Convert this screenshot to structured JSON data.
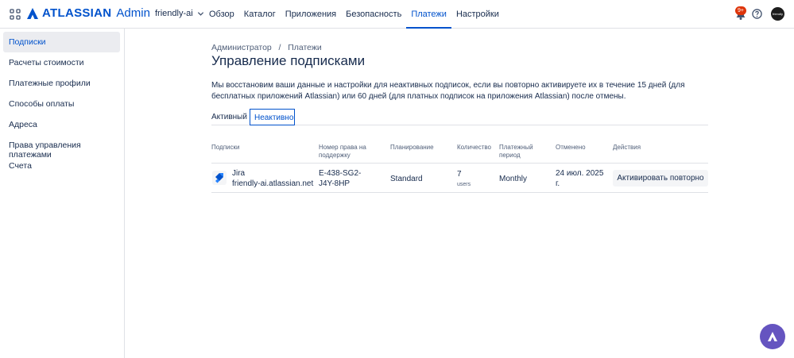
{
  "header": {
    "brand": "ATLASSIAN",
    "product": "Admin",
    "org": "friendly-ai",
    "nav": [
      "Обзор",
      "Каталог",
      "Приложения",
      "Безопасность",
      "Платежи",
      "Настройки"
    ],
    "active_nav": "Платежи",
    "notif_badge": "9+",
    "avatar_text": "friendly"
  },
  "sidebar": {
    "items": [
      "Подписки",
      "Расчеты стоимости",
      "Платежные профили",
      "Способы оплаты",
      "Адреса",
      "Права управления платежами",
      "Счета"
    ],
    "active": "Подписки"
  },
  "main": {
    "breadcrumb": [
      "Администратор",
      "Платежи"
    ],
    "title": "Управление подписками",
    "description": "Мы восстановим ваши данные и настройки для неактивных подписок, если вы повторно активируете их в течение 15 дней (для бесплатных приложений Atlassian) или 60 дней (для платных подписок на приложения Atlassian) после отмены.",
    "tabs": [
      "Активный",
      "Неактивно"
    ],
    "active_tab": "Неактивно",
    "table": {
      "headers": [
        "Подписки",
        "Номер права на поддержку",
        "Планирование",
        "Количество",
        "Платежный период",
        "Отменено",
        "Действия"
      ],
      "rows": [
        {
          "product": "Jira",
          "site": "friendly-ai.atlassian.net",
          "entitlement": "E-438-SG2-J4Y-8HP",
          "plan": "Standard",
          "quantity": "7",
          "quantity_unit": "users",
          "billing_period": "Monthly",
          "cancelled": "24 июл. 2025 г.",
          "action": "Активировать повторно"
        }
      ]
    }
  },
  "colors": {
    "accent": "#0052cc",
    "fab": "#6554c0",
    "badge": "#de350b"
  }
}
